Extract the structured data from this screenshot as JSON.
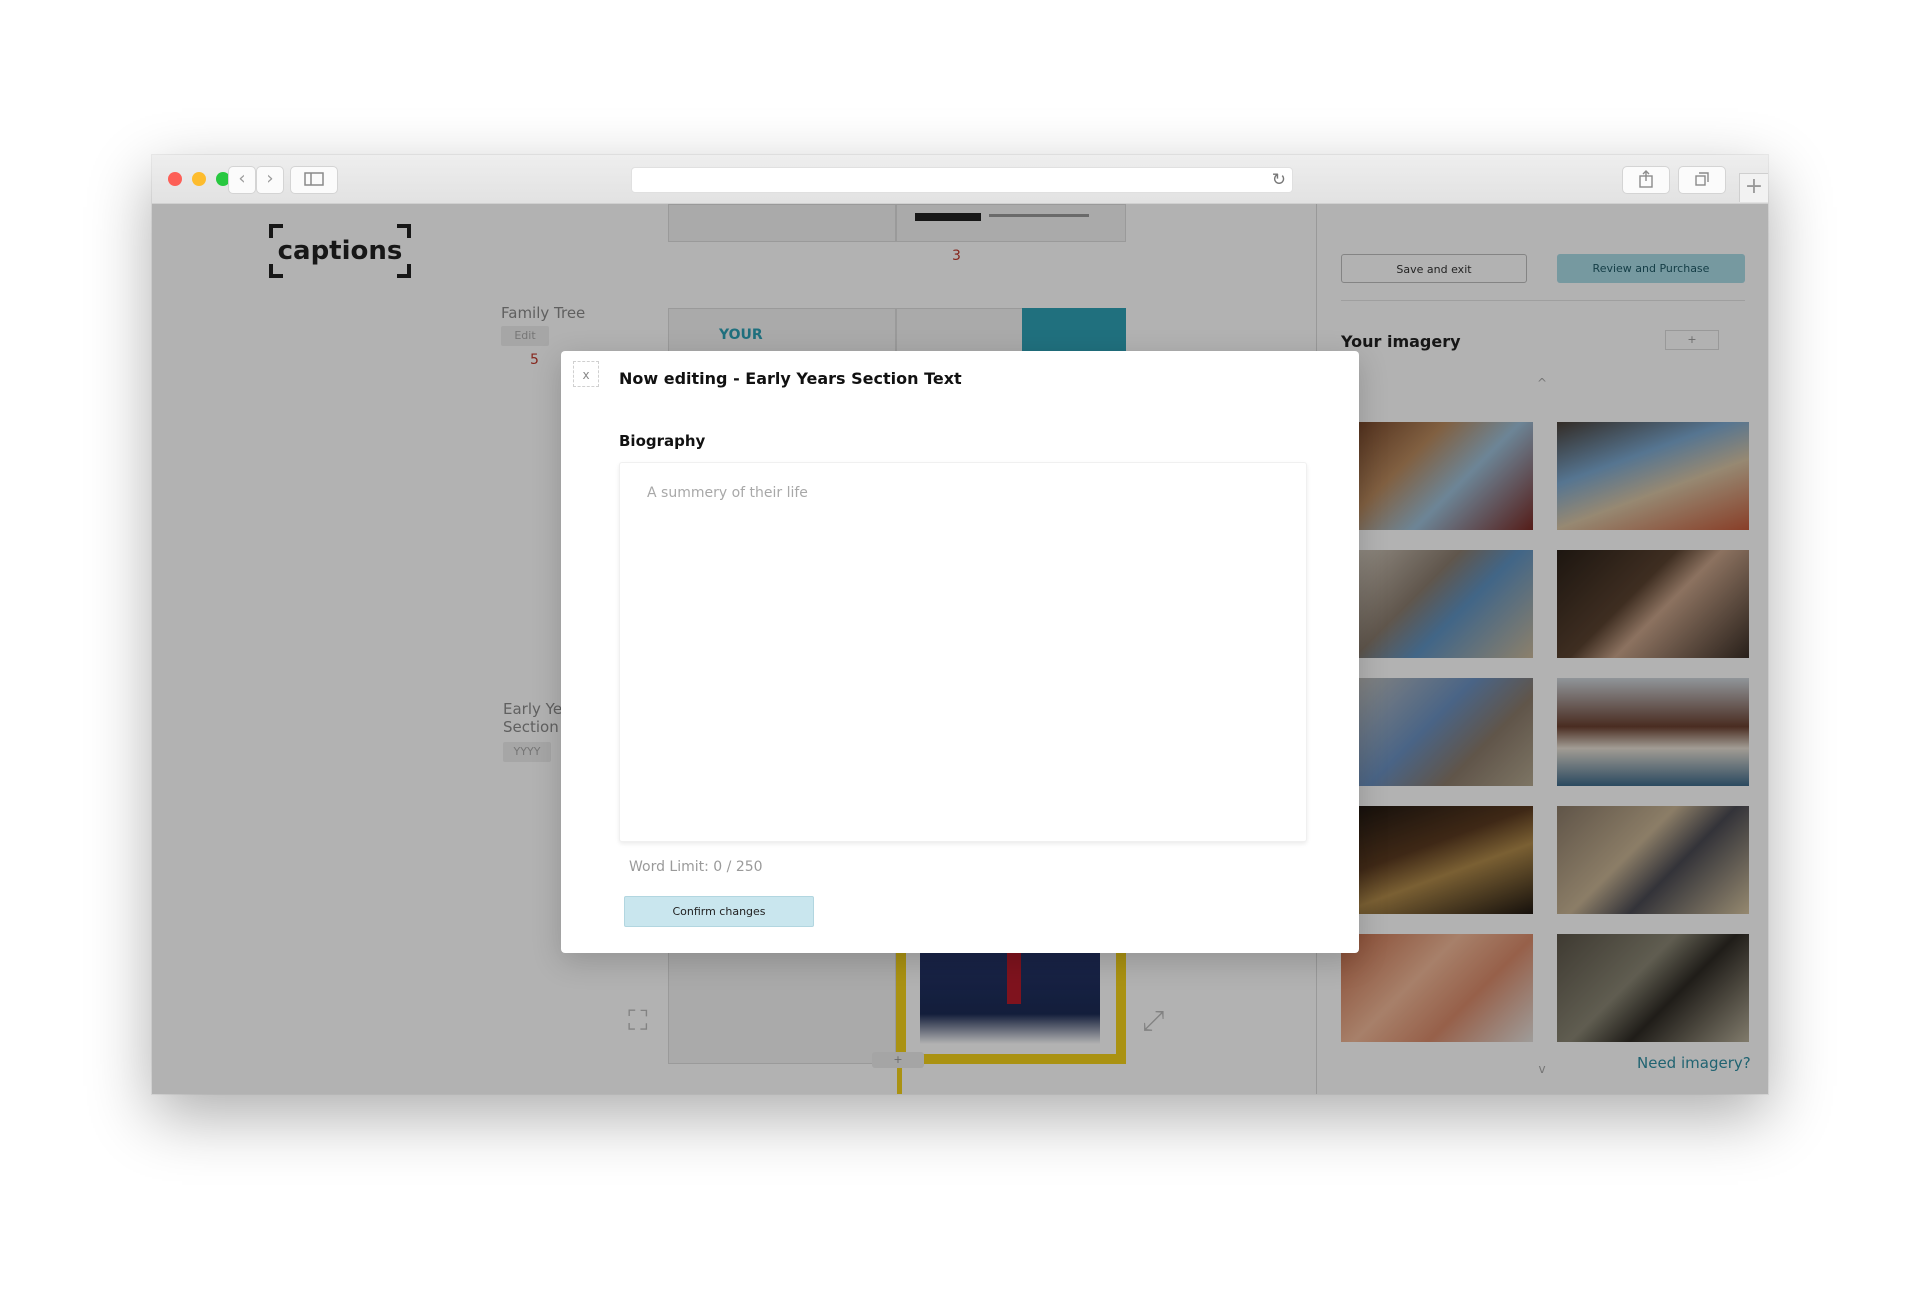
{
  "browser": {
    "url": "",
    "buttons": {
      "back": "‹",
      "forward": "›",
      "reload": "↻",
      "new_tab": "+"
    }
  },
  "app": {
    "logo_text": "captions"
  },
  "left_panel": {
    "family_tree_label": "Family Tree",
    "family_tree_edit": "Edit",
    "family_tree_page": "5",
    "early_years_label_line1": "Early Ye",
    "early_years_label_line2": "Section",
    "early_years_pill": "YYYY"
  },
  "center": {
    "top_page_number": "3",
    "your_text": "YOUR",
    "dash_tab": "+"
  },
  "sidebar": {
    "save_label": "Save and exit",
    "review_label": "Review and Purchase",
    "imagery_title": "Your imagery",
    "add_label": "+",
    "scroll_up": "^",
    "scroll_down": "v",
    "need_imagery": "Need imagery?"
  },
  "modal": {
    "close_label": "x",
    "title": "Now editing - Early Years Section Text",
    "section_label": "Biography",
    "bio_placeholder": "A summery of their life",
    "bio_value": "",
    "word_limit": "Word Limit: 0 / 250",
    "confirm_label": "Confirm changes"
  },
  "colors": {
    "accent_teal": "#2ea1b5",
    "review_button": "#a9dbe6",
    "confirm_button": "#c9e6ee",
    "page_number_red": "#c0392b",
    "yellow_frame": "#f4d21a"
  }
}
